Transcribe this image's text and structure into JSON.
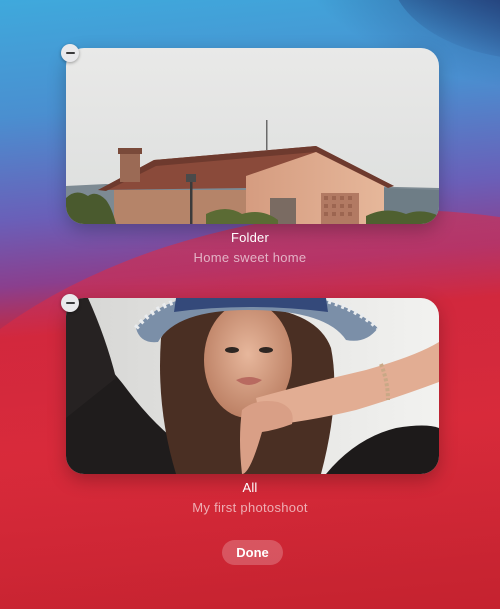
{
  "widgets": [
    {
      "title": "Folder",
      "subtitle": "Home sweet home",
      "image": "house-photo"
    },
    {
      "title": "All",
      "subtitle": "My first photoshoot",
      "image": "portrait-photo"
    }
  ],
  "actions": {
    "done_label": "Done"
  },
  "icons": {
    "remove": "minus-circle-icon"
  },
  "colors": {
    "wallpaper_top": "#3fa9dc",
    "wallpaper_bottom": "#c5222f",
    "remove_button": "#e9e9ec"
  }
}
